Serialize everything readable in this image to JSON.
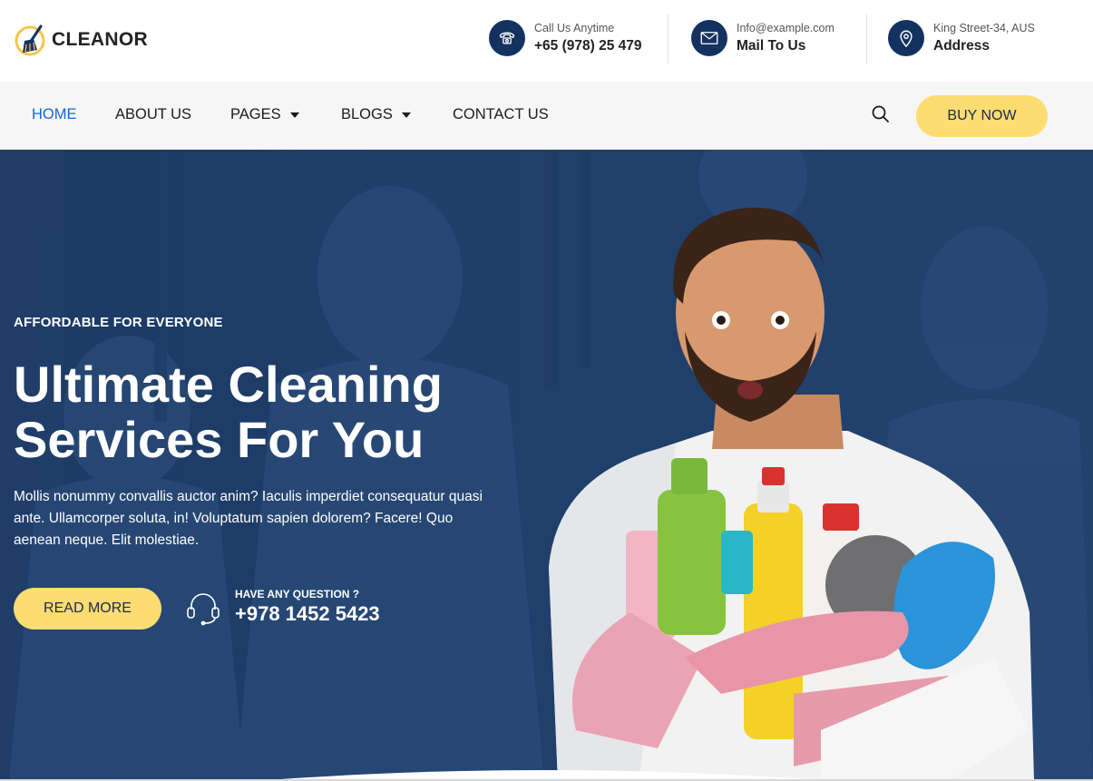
{
  "brand": {
    "name": "CLEANOR",
    "accent": "#fddc72",
    "primary": "#14325f",
    "link_active": "#1565d8"
  },
  "contacts": [
    {
      "icon": "phone-icon",
      "label": "Call Us Anytime",
      "value": "+65 (978) 25 479"
    },
    {
      "icon": "mail-icon",
      "label": "Info@example.com",
      "value": "Mail To Us"
    },
    {
      "icon": "location-pin-icon",
      "label": "King Street-34, AUS",
      "value": "Address"
    }
  ],
  "nav": {
    "items": [
      {
        "label": "HOME",
        "active": true
      },
      {
        "label": "ABOUT US"
      },
      {
        "label": "PAGES",
        "dropdown": true
      },
      {
        "label": "BLOGS",
        "dropdown": true
      },
      {
        "label": "CONTACT US"
      }
    ],
    "buy_label": "BUY NOW"
  },
  "hero": {
    "eyebrow": "AFFORDABLE FOR EVERYONE",
    "headline_line1": "Ultimate Cleaning",
    "headline_line2": "Services For You",
    "description": "Mollis nonummy convallis auctor anim? Iaculis imperdiet consequatur quasi ante. Ullamcorper soluta, in! Voluptatum sapien dolorem? Facere! Quo aenean neque. Elit molestiae.",
    "read_more": "READ MORE",
    "question_label": "HAVE ANY QUESTION ?",
    "question_phone": "+978 1452 5423"
  }
}
